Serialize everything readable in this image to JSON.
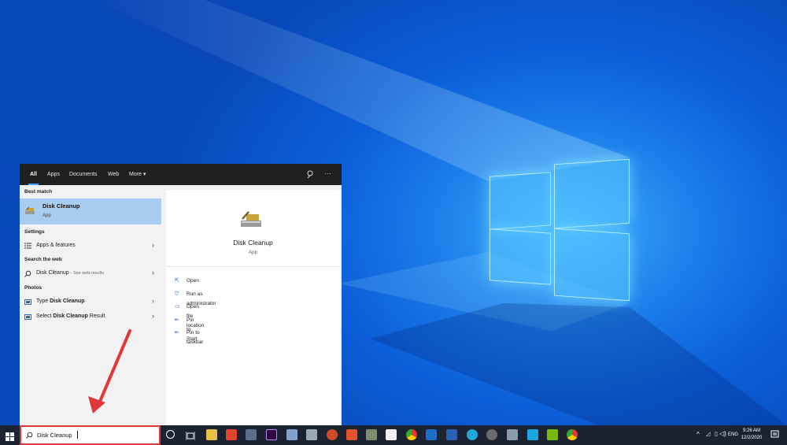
{
  "search_panel": {
    "tabs": [
      "All",
      "Apps",
      "Documents",
      "Web",
      "More"
    ],
    "more_caret": "▾",
    "best_match_heading": "Best match",
    "best_match": {
      "title": "Disk Cleanup",
      "subtitle": "App"
    },
    "settings_heading": "Settings",
    "settings_items": [
      {
        "label": "Apps & features"
      }
    ],
    "web_heading": "Search the web",
    "web_item": {
      "label": "Disk Cleanup",
      "suffix": "- See web results"
    },
    "photos_heading": "Photos",
    "photos_items": [
      {
        "prefix": "Type ",
        "bold": "Disk Cleanup",
        "suffix": ""
      },
      {
        "prefix": "Select ",
        "bold": "Disk Cleanup",
        "suffix": " Result"
      }
    ],
    "preview": {
      "title": "Disk Cleanup",
      "subtitle": "App",
      "actions": [
        {
          "label": "Open",
          "icon": "open-icon"
        },
        {
          "label": "Run as administrator",
          "icon": "shield-icon"
        },
        {
          "label": "Open file location",
          "icon": "folder-icon"
        },
        {
          "label": "Pin to Start",
          "icon": "pin-icon"
        },
        {
          "label": "Pin to taskbar",
          "icon": "pin-icon"
        }
      ]
    }
  },
  "taskbar": {
    "search_value": "Disk Cleanup",
    "tray": {
      "language": "ENG",
      "time": "9:26 AM",
      "date": "12/2/2020"
    }
  },
  "colors": {
    "accent": "#4aa0ff",
    "highlight": "#a9cdf0",
    "annotation": "#e0383a",
    "taskbar": "#1b2333"
  }
}
